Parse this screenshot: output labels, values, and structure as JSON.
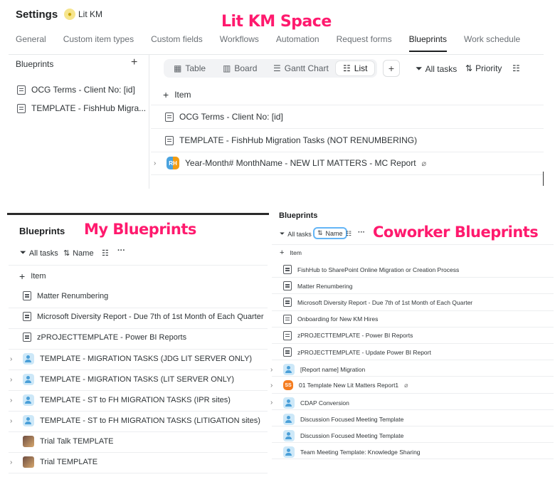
{
  "annotations": {
    "lit_km_space": "Lit KM Space",
    "my_blueprints": "My Blueprints",
    "coworker_blueprints": "Coworker Blueprints"
  },
  "settings": {
    "title": "Settings",
    "space_name": "Lit KM",
    "tabs": [
      "General",
      "Custom item types",
      "Custom fields",
      "Workflows",
      "Automation",
      "Request forms",
      "Blueprints",
      "Work schedule"
    ],
    "active_tab": "Blueprints"
  },
  "blueprints_sidebar": {
    "heading": "Blueprints",
    "add": "+",
    "items": [
      "OCG Terms - Client No: [id]",
      "TEMPLATE - FishHub Migra..."
    ]
  },
  "view_switcher": {
    "views": [
      "Table",
      "Board",
      "Gantt Chart",
      "List"
    ],
    "active": "List",
    "add": "+"
  },
  "toolbar": {
    "all_tasks": "All tasks",
    "priority": "Priority"
  },
  "top_list": {
    "add_item": "Item",
    "rows": [
      {
        "label": "OCG Terms - Client No: [id]",
        "icon": "template-icon"
      },
      {
        "label": "TEMPLATE - FishHub Migration Tasks (NOT RENUMBERING)",
        "icon": "template-icon"
      },
      {
        "label": "Year-Month# MonthName - NEW LIT MATTERS - MC Report",
        "icon": "avatar-rh",
        "avatar_text": "RH",
        "colors": [
          "#4aa3df",
          "#f39c12"
        ]
      }
    ]
  },
  "my_blueprints": {
    "title": "Blueprints",
    "toolbar": {
      "all_tasks": "All tasks",
      "name": "Name"
    },
    "add_item": "Item",
    "rows": [
      {
        "label": "Matter Renumbering",
        "icon": "template-icon",
        "expand": false
      },
      {
        "label": "Microsoft Diversity Report - Due 7th of 1st Month of Each Quarter",
        "icon": "template-icon",
        "expand": false
      },
      {
        "label": "zPROJECTTEMPLATE - Power BI Reports",
        "icon": "template-icon",
        "expand": false
      },
      {
        "label": "TEMPLATE - MIGRATION TASKS (JDG LIT SERVER ONLY)",
        "icon": "people-icon",
        "expand": true
      },
      {
        "label": "TEMPLATE - MIGRATION TASKS (LIT SERVER ONLY)",
        "icon": "people-icon",
        "expand": true
      },
      {
        "label": "TEMPLATE - ST to FH MIGRATION TASKS (IPR sites)",
        "icon": "people-icon",
        "expand": true
      },
      {
        "label": "TEMPLATE - ST to FH MIGRATION TASKS (LITIGATION sites)",
        "icon": "people-icon",
        "expand": true
      },
      {
        "label": "Trial Talk TEMPLATE",
        "icon": "photo-icon",
        "expand": false
      },
      {
        "label": "Trial TEMPLATE",
        "icon": "photo-icon",
        "expand": true
      }
    ]
  },
  "coworker_blueprints": {
    "title": "Blueprints",
    "toolbar": {
      "all_tasks": "All tasks",
      "name": "Name"
    },
    "add_item": "Item",
    "rows": [
      {
        "label": "FishHub to SharePoint Online Migration or Creation Process",
        "icon": "template-icon",
        "expand": false
      },
      {
        "label": "Matter Renumbering",
        "icon": "template-icon",
        "expand": false
      },
      {
        "label": "Microsoft Diversity Report - Due 7th of 1st Month of Each Quarter",
        "icon": "template-icon",
        "expand": false
      },
      {
        "label": "Onboarding for New KM Hires",
        "icon": "template-icon",
        "expand": false
      },
      {
        "label": "zPROJECTTEMPLATE - Power BI Reports",
        "icon": "template-icon",
        "expand": false
      },
      {
        "label": "zPROJECTTEMPLATE - Update Power BI Report",
        "icon": "template-icon",
        "expand": false
      },
      {
        "label": "[Report name] Migration",
        "icon": "people-icon",
        "expand": true
      },
      {
        "label": "01 Template New Lit Matters Report1",
        "icon": "avatar-ss",
        "avatar_text": "SS",
        "expand": true
      },
      {
        "label": "CDAP Conversion",
        "icon": "people-icon",
        "expand": true
      },
      {
        "label": "Discussion Focused Meeting Template",
        "icon": "people-icon",
        "expand": false
      },
      {
        "label": "Discussion Focused Meeting Template",
        "icon": "people-icon",
        "expand": false
      },
      {
        "label": "Team Meeting Template: Knowledge Sharing",
        "icon": "people-icon",
        "expand": false
      }
    ]
  },
  "colors": {
    "annotation": "#ff1a6e",
    "name_pill_border": "#64b5f6",
    "ss_avatar": "#f57c1f"
  }
}
